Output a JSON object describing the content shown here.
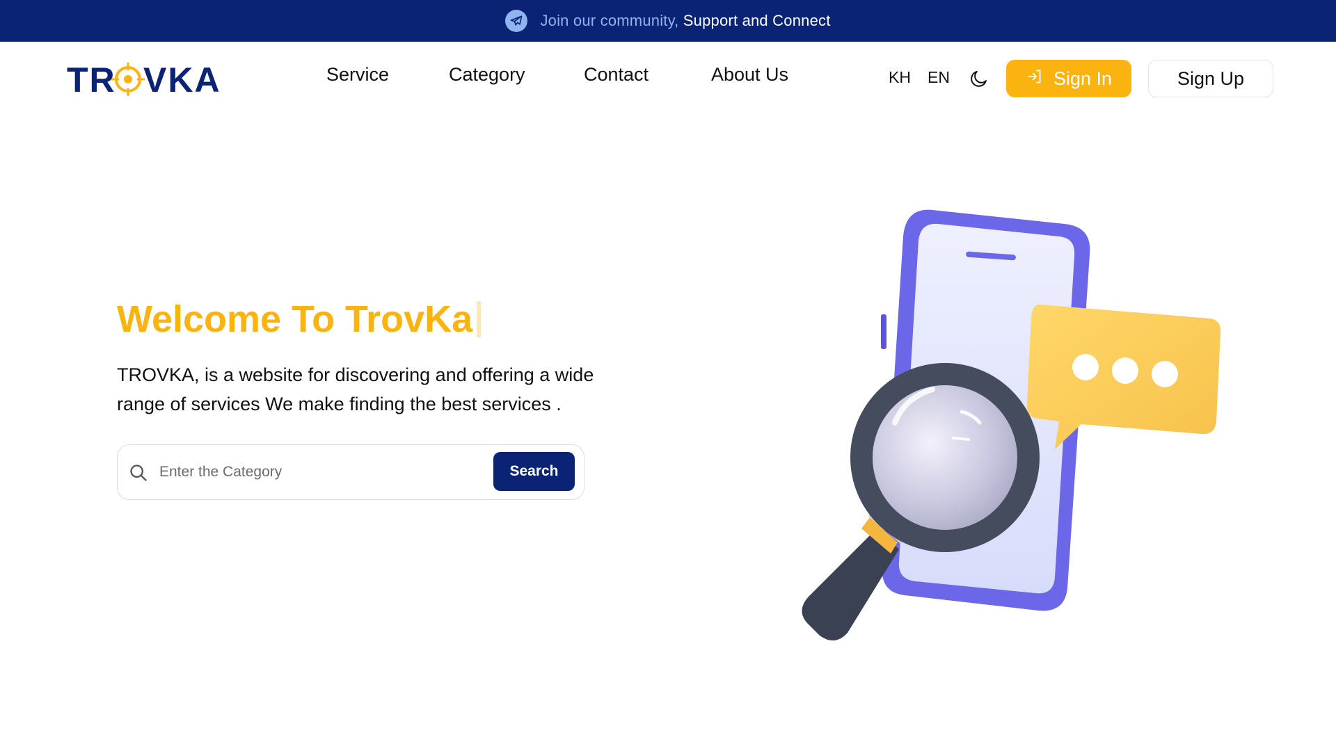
{
  "announcement": {
    "icon": "telegram-icon",
    "accent_text": "Join our community,",
    "text": "Support and Connect"
  },
  "brand": {
    "logo_text": "TROVKA",
    "primary_color": "#0a2374",
    "accent_color": "#fbb40f"
  },
  "nav": {
    "items": [
      {
        "label": "Service"
      },
      {
        "label": "Category"
      },
      {
        "label": "Contact"
      },
      {
        "label": "About Us"
      }
    ]
  },
  "header": {
    "languages": [
      "KH",
      "EN"
    ],
    "theme_toggle_icon": "moon-icon",
    "sign_in_label": "Sign In",
    "sign_in_icon": "login-icon",
    "sign_up_label": "Sign Up"
  },
  "hero": {
    "title": "Welcome To TrovKa",
    "description": "TROVKA, is a website for discovering and offering a wide range of services We make finding the best services .",
    "search": {
      "placeholder": "Enter the Category",
      "value": "",
      "button_label": "Search",
      "icon": "search-icon"
    },
    "illustration": "phone-with-magnifier-and-chat-bubble"
  }
}
